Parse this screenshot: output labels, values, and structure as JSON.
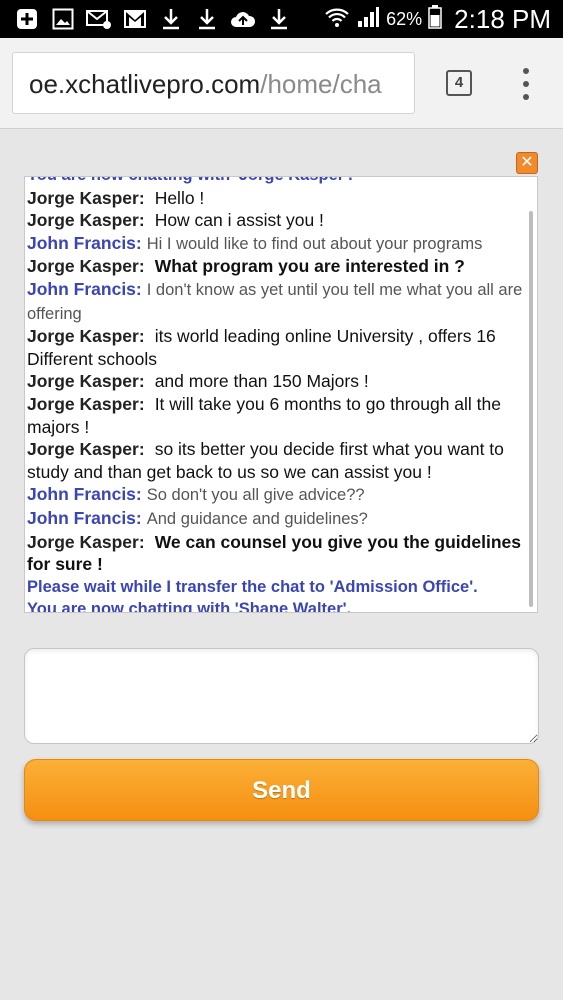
{
  "status_bar": {
    "battery_percent": "62%",
    "time": "2:18 PM",
    "icons": [
      "add-icon",
      "image-icon",
      "voicemail-icon",
      "gmail-icon",
      "download-icon",
      "download-icon",
      "upload-cloud-icon",
      "download-icon",
      "wifi-icon",
      "signal-icon",
      "battery-icon"
    ]
  },
  "browser": {
    "url_host": "oe.xchatlivepro.com",
    "url_path": "/home/cha",
    "tab_count": "4"
  },
  "chat": {
    "close_label": "✕",
    "messages": [
      {
        "kind": "system",
        "text": "You are now chatting with 'Jorge Kasper'."
      },
      {
        "kind": "agent",
        "name": "Jorge Kasper:",
        "text": "Hello !",
        "bold": false
      },
      {
        "kind": "agent",
        "name": "Jorge Kasper:",
        "text": "How can i assist you !",
        "bold": false
      },
      {
        "kind": "user",
        "name": "John Francis:",
        "text": "Hi I would like to find out about your programs"
      },
      {
        "kind": "agent",
        "name": "Jorge Kasper:",
        "text": "What program you are interested in ?",
        "bold": true
      },
      {
        "kind": "user",
        "name": "John Francis:",
        "text": "I don't know as yet until you tell me what you all are offering"
      },
      {
        "kind": "agent",
        "name": "Jorge Kasper:",
        "text": "its world leading online University , offers 16 Different schools",
        "bold": false
      },
      {
        "kind": "agent",
        "name": "Jorge Kasper:",
        "text": "and more than 150 Majors !",
        "bold": false
      },
      {
        "kind": "agent",
        "name": "Jorge Kasper:",
        "text": "It will take you 6 months to go through all the majors !",
        "bold": false
      },
      {
        "kind": "agent",
        "name": "Jorge Kasper:",
        "text": "so its better you decide first what you want to study and than get back to us so we can assist you !",
        "bold": false
      },
      {
        "kind": "user",
        "name": "John Francis:",
        "text": "So don't you all give advice??"
      },
      {
        "kind": "user",
        "name": "John Francis:",
        "text": "And guidance and guidelines?"
      },
      {
        "kind": "agent",
        "name": "Jorge Kasper:",
        "text": "We can counsel you give you the guidelines for sure !",
        "bold": true
      },
      {
        "kind": "system",
        "text": "Please wait while I transfer the chat to 'Admission Office'."
      },
      {
        "kind": "system",
        "text": "You are now chatting with 'Shane Walter'."
      }
    ]
  },
  "composer": {
    "input_value": "",
    "send_label": "Send"
  }
}
